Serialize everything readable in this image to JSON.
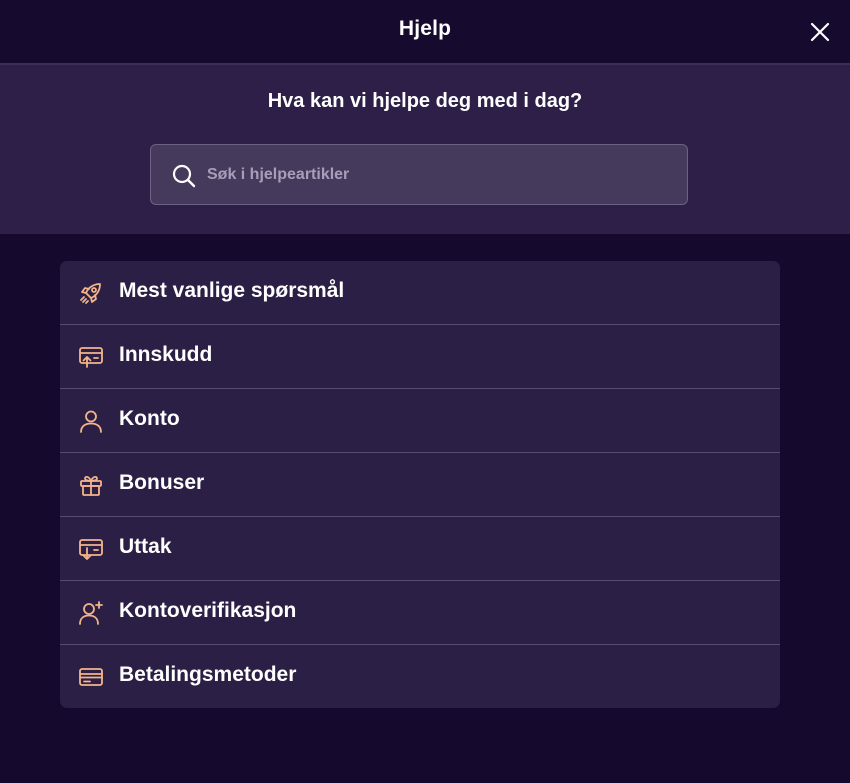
{
  "header": {
    "title": "Hjelp"
  },
  "hero": {
    "heading": "Hva kan vi hjelpe deg med i dag?",
    "search": {
      "placeholder": "Søk i hjelpeartikler",
      "value": ""
    }
  },
  "menu": {
    "items": [
      {
        "label": "Mest vanlige spørsmål",
        "icon": "rocket-icon"
      },
      {
        "label": "Innskudd",
        "icon": "deposit-icon"
      },
      {
        "label": "Konto",
        "icon": "user-icon"
      },
      {
        "label": "Bonuser",
        "icon": "gift-icon"
      },
      {
        "label": "Uttak",
        "icon": "withdraw-icon"
      },
      {
        "label": "Kontoverifikasjon",
        "icon": "user-add-icon"
      },
      {
        "label": "Betalingsmetoder",
        "icon": "credit-card-icon"
      }
    ]
  },
  "colors": {
    "background": "#150a2e",
    "panel": "#2d1f48",
    "menu_background": "#2b1f45",
    "search_background": "#463a5c",
    "icon_accent": "#f4b48a",
    "text": "#ffffff"
  }
}
